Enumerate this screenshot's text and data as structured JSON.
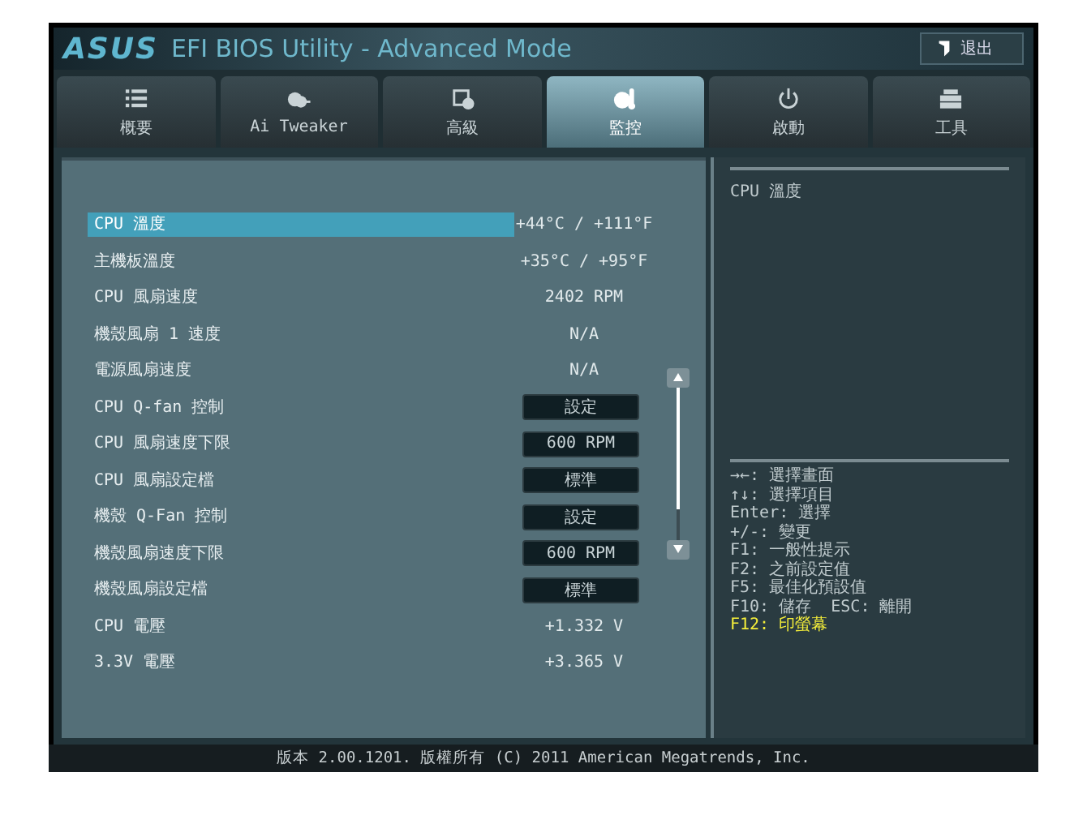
{
  "window": {
    "brand": "ASUS",
    "title": "EFI BIOS Utility - Advanced Mode",
    "exit_button": "退出"
  },
  "tabs": [
    {
      "label": "概要",
      "selected": false
    },
    {
      "label": "Ai Tweaker",
      "selected": false
    },
    {
      "label": "高級",
      "selected": false
    },
    {
      "label": "監控",
      "selected": true
    },
    {
      "label": "啟動",
      "selected": false
    },
    {
      "label": "工具",
      "selected": false
    }
  ],
  "settings": [
    {
      "label": "CPU 溫度",
      "kind": "value",
      "value": "+44°C / +111°F",
      "selected": true
    },
    {
      "label": "主機板溫度",
      "kind": "value",
      "value": "+35°C / +95°F",
      "selected": false
    },
    {
      "label": "CPU 風扇速度",
      "kind": "value",
      "value": "2402 RPM",
      "selected": false
    },
    {
      "label": "機殼風扇 1 速度",
      "kind": "value",
      "value": "N/A",
      "selected": false
    },
    {
      "label": "電源風扇速度",
      "kind": "value",
      "value": "N/A",
      "selected": false
    },
    {
      "label": "CPU Q-fan 控制",
      "kind": "button",
      "value": "設定",
      "selected": false
    },
    {
      "label": "CPU 風扇速度下限",
      "kind": "button",
      "value": "600 RPM",
      "selected": false
    },
    {
      "label": "CPU 風扇設定檔",
      "kind": "button",
      "value": "標準",
      "selected": false
    },
    {
      "label": "機殼 Q-Fan 控制",
      "kind": "button",
      "value": "設定",
      "selected": false
    },
    {
      "label": "機殼風扇速度下限",
      "kind": "button",
      "value": "600 RPM",
      "selected": false
    },
    {
      "label": "機殼風扇設定檔",
      "kind": "button",
      "value": "標準",
      "selected": false
    },
    {
      "label": "CPU 電壓",
      "kind": "value",
      "value": "+1.332 V",
      "selected": false
    },
    {
      "label": "3.3V 電壓",
      "kind": "value",
      "value": "+3.365 V",
      "selected": false
    }
  ],
  "help": {
    "description": "CPU 溫度",
    "keys": [
      {
        "text": "→←: 選擇畫面",
        "kind": "normal"
      },
      {
        "text": "↑↓: 選擇項目",
        "kind": "normal"
      },
      {
        "text": "Enter: 選擇",
        "kind": "normal"
      },
      {
        "text": "+/-: 變更",
        "kind": "normal"
      },
      {
        "text": "F1: 一般性提示",
        "kind": "normal"
      },
      {
        "text": "F2: 之前設定值",
        "kind": "normal"
      },
      {
        "text": "F5: 最佳化預設值",
        "kind": "normal"
      },
      {
        "text": "F10: 儲存  ESC: 離開",
        "kind": "normal"
      },
      {
        "text": "F12: 印螢幕",
        "kind": "highlight"
      }
    ]
  },
  "footer": "版本 2.00.1201. 版權所有 (C) 2011 American Megatrends, Inc."
}
